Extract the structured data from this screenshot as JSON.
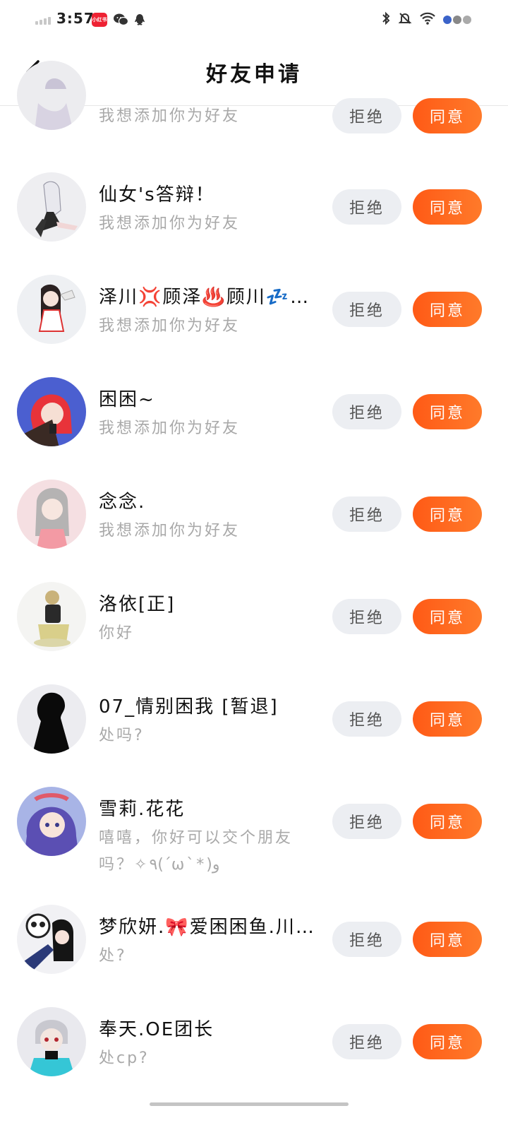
{
  "status_bar": {
    "time": "3:57",
    "app_badge": "小红书",
    "icons": [
      "signal-icon",
      "redbook-icon",
      "wechat-icon",
      "qq-icon",
      "bluetooth-icon",
      "mute-bell-icon",
      "wifi-icon",
      "dot-indicators"
    ]
  },
  "header": {
    "back_icon": "chevron-left-icon",
    "title": "好友申请"
  },
  "buttons": {
    "reject": "拒绝",
    "accept": "同意"
  },
  "requests": [
    {
      "name": "",
      "message": "我想添加你为好友"
    },
    {
      "name": "仙女's答辩！",
      "message": "我想添加你为好友"
    },
    {
      "name": "泽川💢顾泽♨️顾川💤…",
      "message": "我想添加你为好友"
    },
    {
      "name": "困困~",
      "message": "我想添加你为好友"
    },
    {
      "name": "念念.",
      "message": "我想添加你为好友"
    },
    {
      "name": "洛依[正]",
      "message": "你好"
    },
    {
      "name": "07_情别困我 [暂退]",
      "message": "处吗?"
    },
    {
      "name": "雪莉.花花",
      "message": "嘻嘻，你好可以交个朋友吗？✧٩(ˊωˋ*)و"
    },
    {
      "name": "梦欣妍.🎀爱困困鱼.川…",
      "message": "处?"
    },
    {
      "name": "奉天.OE团长",
      "message": "处cp?"
    }
  ],
  "colors": {
    "accent": "#ff5a16",
    "reject_bg": "#eceef2",
    "muted_text": "#a9a9a9"
  }
}
